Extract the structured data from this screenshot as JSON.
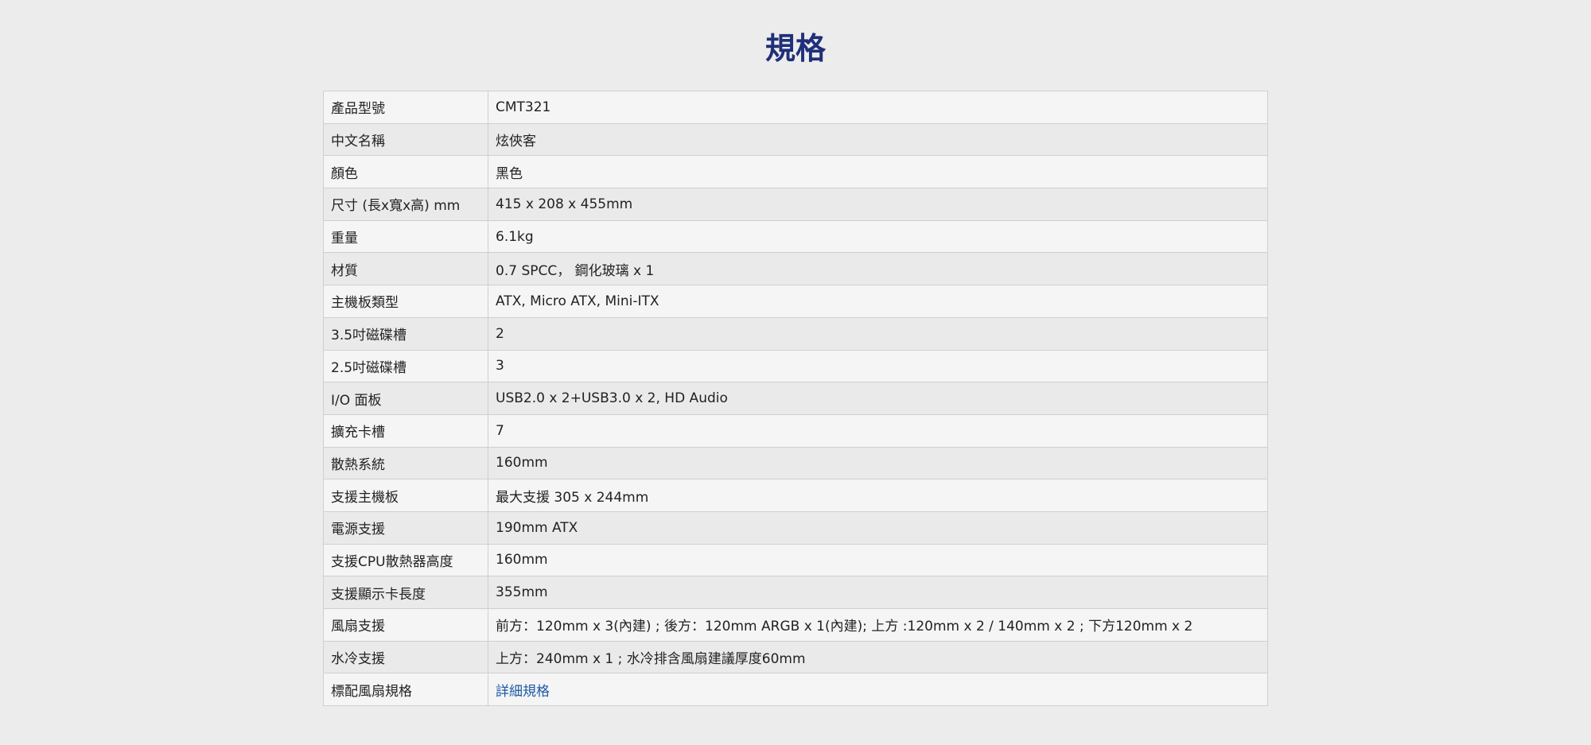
{
  "title": "規格",
  "specs": [
    {
      "label": "產品型號",
      "value": "CMT321"
    },
    {
      "label": "中文名稱",
      "value": "炫俠客"
    },
    {
      "label": "顏色",
      "value": "黑色"
    },
    {
      "label": "尺寸 (長x寬x高) mm",
      "value": "415 x 208 x 455mm"
    },
    {
      "label": "重量",
      "value": "6.1kg"
    },
    {
      "label": "材質",
      "value": "0.7 SPCC， 鋼化玻璃 x 1"
    },
    {
      "label": "主機板類型",
      "value": "ATX, Micro ATX, Mini-ITX"
    },
    {
      "label": "3.5吋磁碟槽",
      "value": "2"
    },
    {
      "label": "2.5吋磁碟槽",
      "value": "3"
    },
    {
      "label": "I/O 面板",
      "value": "USB2.0 x 2+USB3.0 x 2, HD Audio"
    },
    {
      "label": "擴充卡槽",
      "value": "7"
    },
    {
      "label": "散熱系統",
      "value": "160mm"
    },
    {
      "label": "支援主機板",
      "value": "最大支援 305 x 244mm"
    },
    {
      "label": "電源支援",
      "value": "190mm ATX"
    },
    {
      "label": "支援CPU散熱器高度",
      "value": "160mm"
    },
    {
      "label": "支援顯示卡長度",
      "value": "355mm"
    },
    {
      "label": "風扇支援",
      "value": "前方：120mm x 3(內建) ; 後方：120mm ARGB x 1(內建); 上方 :120mm x 2 / 140mm x 2 ; 下方120mm x 2"
    },
    {
      "label": "水冷支援",
      "value": "上方：240mm x 1 ; 水冷排含風扇建議厚度60mm"
    },
    {
      "label": "標配風扇規格",
      "value": "詳細規格"
    }
  ]
}
